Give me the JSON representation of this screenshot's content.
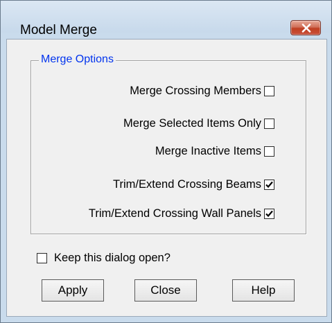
{
  "window": {
    "title": "Model Merge"
  },
  "group": {
    "legend": "Merge Options"
  },
  "options": [
    {
      "label": "Merge Crossing Members",
      "checked": false
    },
    {
      "label": "Merge Selected Items Only",
      "checked": false
    },
    {
      "label": "Merge Inactive Items",
      "checked": false
    },
    {
      "label": "Trim/Extend Crossing Beams",
      "checked": true
    },
    {
      "label": "Trim/Extend Crossing Wall Panels",
      "checked": true
    }
  ],
  "keep_open": {
    "label": "Keep this dialog open?",
    "checked": false
  },
  "buttons": {
    "apply": "Apply",
    "close": "Close",
    "help": "Help"
  },
  "colors": {
    "legend_text": "#0033ee",
    "close_button": "#c9503a",
    "titlebar": "#c9dbec"
  },
  "icons": {
    "close": "close-x-icon",
    "check": "checkmark-icon"
  }
}
